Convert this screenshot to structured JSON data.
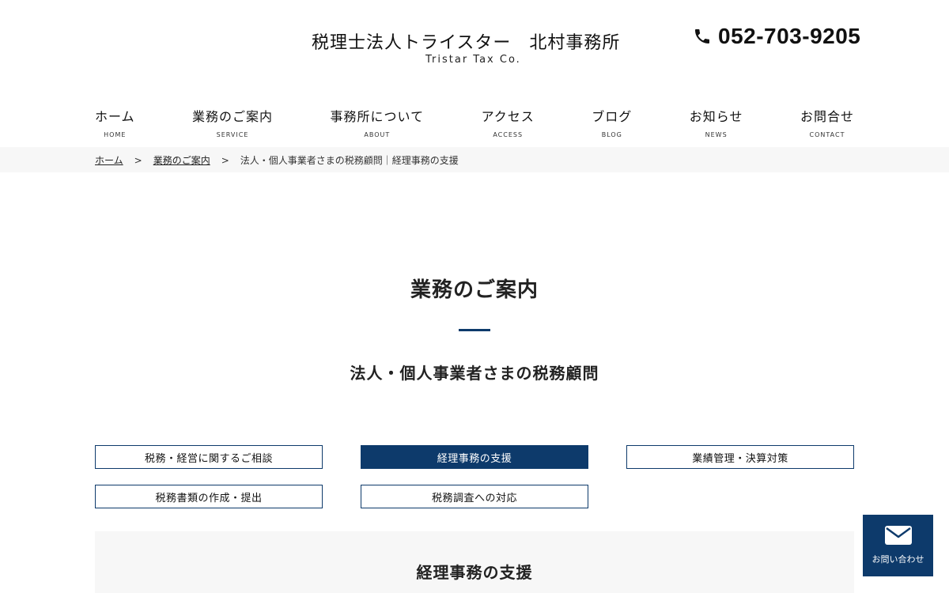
{
  "header": {
    "logo_main": "税理士法人トライスター　北村事務所",
    "logo_sub": "Tristar Tax Co.",
    "phone_number": "052-703-9205"
  },
  "nav": {
    "items": [
      {
        "jp": "ホーム",
        "en": "HOME"
      },
      {
        "jp": "業務のご案内",
        "en": "SERVICE"
      },
      {
        "jp": "事務所について",
        "en": "ABOUT"
      },
      {
        "jp": "アクセス",
        "en": "ACCESS"
      },
      {
        "jp": "ブログ",
        "en": "BLOG"
      },
      {
        "jp": "お知らせ",
        "en": "NEWS"
      },
      {
        "jp": "お問合せ",
        "en": "CONTACT"
      }
    ]
  },
  "breadcrumb": {
    "home": "ホーム",
    "sep": ">",
    "service": "業務のご案内",
    "current": "法人・個人事業者さまの税務顧問｜経理事務の支援"
  },
  "page": {
    "title": "業務のご案内",
    "subtitle": "法人・個人事業者さまの税務顧問"
  },
  "subnav": {
    "items": [
      {
        "label": "税務・経営に関するご相談",
        "active": false
      },
      {
        "label": "経理事務の支援",
        "active": true
      },
      {
        "label": "業績管理・決算対策",
        "active": false
      },
      {
        "label": "税務書類の作成・提出",
        "active": false
      },
      {
        "label": "税務調査への対応",
        "active": false
      }
    ]
  },
  "section": {
    "title": "経理事務の支援"
  },
  "contact_float": {
    "label": "お問い合わせ"
  },
  "colors": {
    "brand": "#0d3a6b",
    "breadcrumb_bg": "#f7f7f7"
  }
}
